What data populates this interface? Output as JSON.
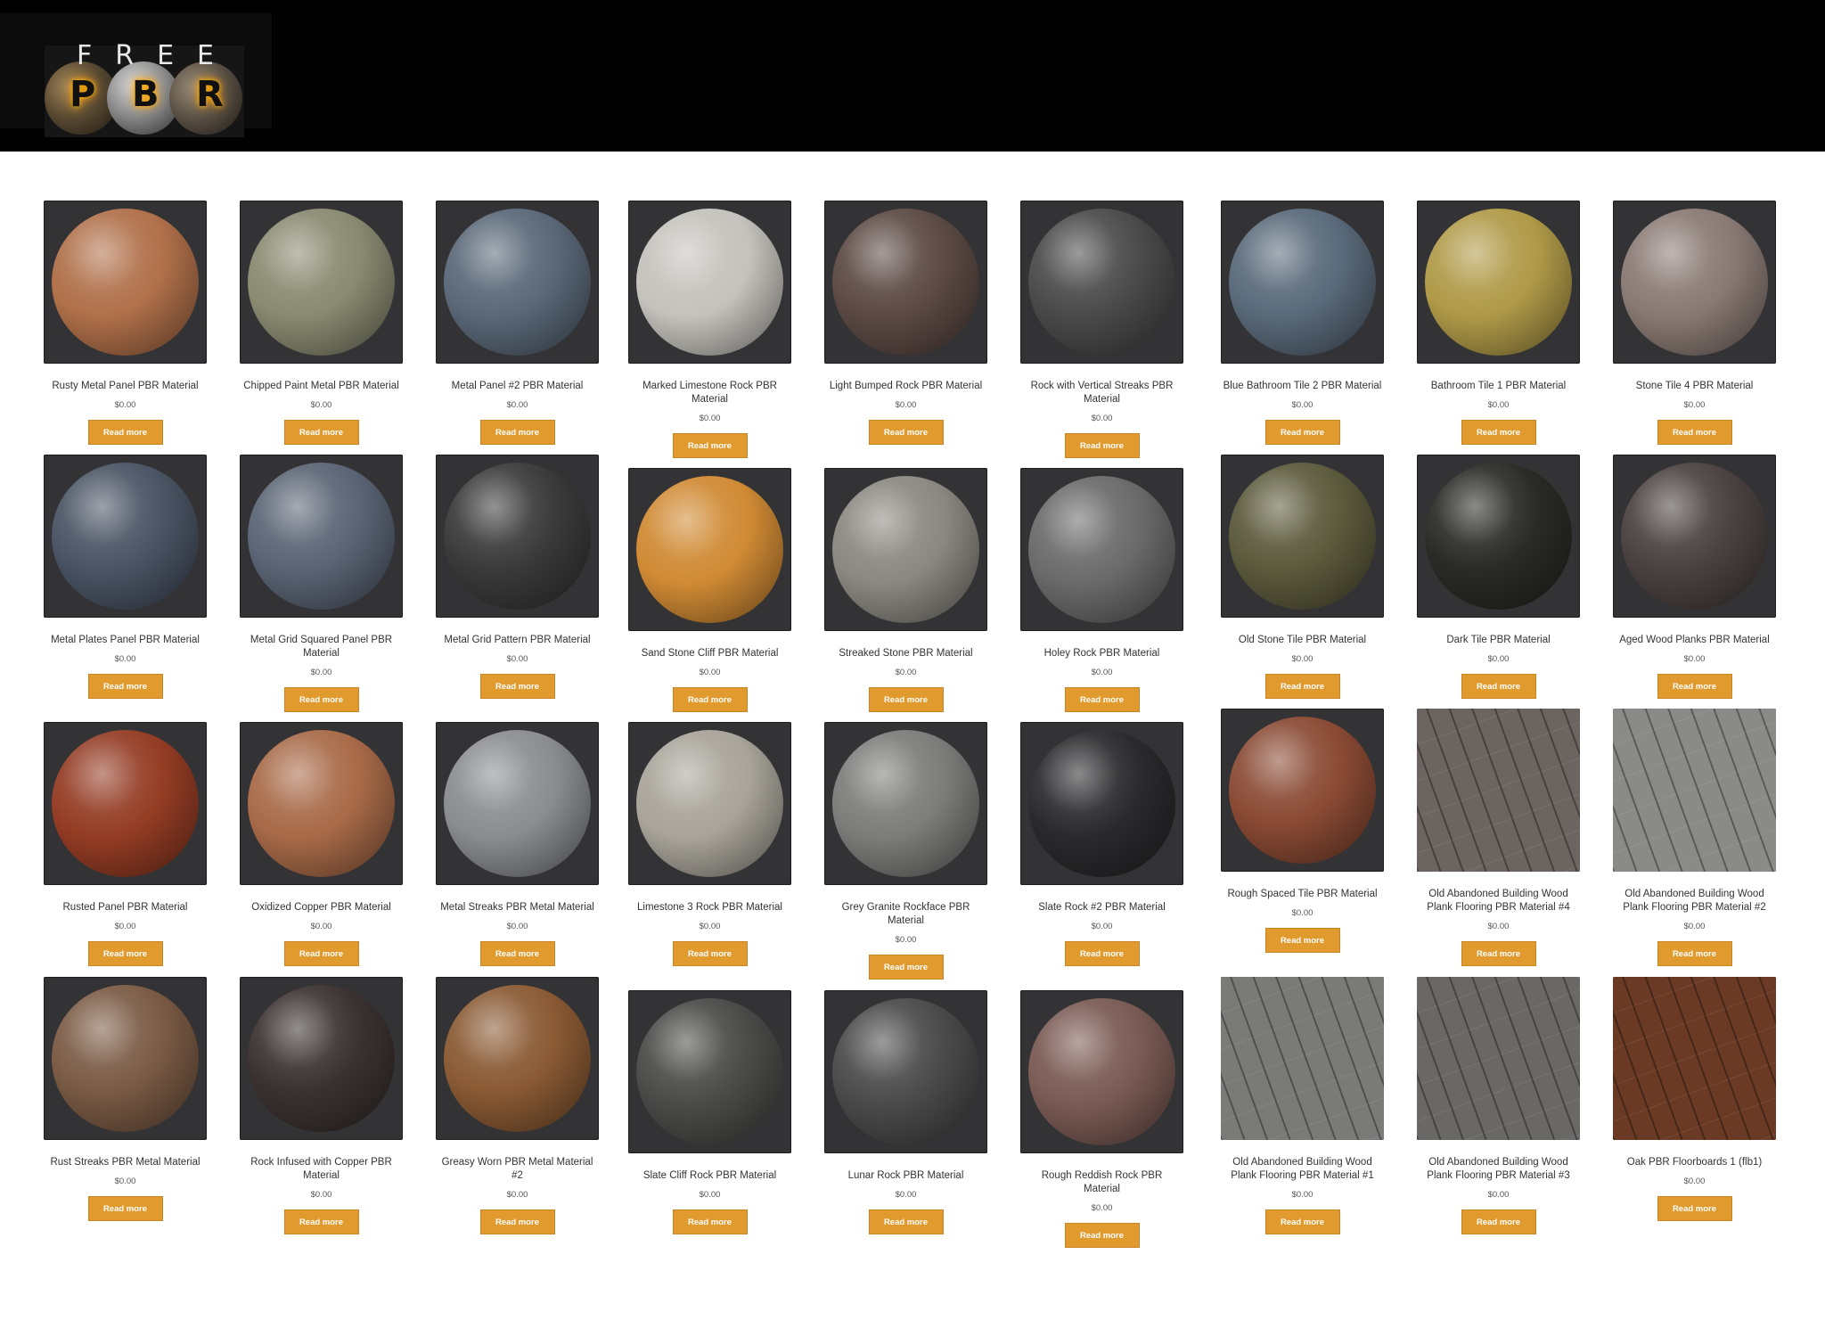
{
  "logo": {
    "top_text": "FREE",
    "letters": [
      "P",
      "B",
      "R"
    ]
  },
  "products": [
    {
      "title": "Rusty Metal Panel PBR Material",
      "price": "$0.00",
      "button": "Read more",
      "color": "#b0704a"
    },
    {
      "title": "Chipped Paint Metal PBR Material",
      "price": "$0.00",
      "button": "Read more",
      "color": "#8a8a72"
    },
    {
      "title": "Metal Panel #2 PBR Material",
      "price": "$0.00",
      "button": "Read more",
      "color": "#5a6878"
    },
    {
      "title": "Marked Limestone Rock PBR Material",
      "price": "$0.00",
      "button": "Read more",
      "color": "#c4c2bc"
    },
    {
      "title": "Light Bumped Rock PBR Material",
      "price": "$0.00",
      "button": "Read more",
      "color": "#5c4a44"
    },
    {
      "title": "Rock with Vertical Streaks PBR Material",
      "price": "$0.00",
      "button": "Read more",
      "color": "#4a4a4a"
    },
    {
      "title": "Blue Bathroom Tile 2 PBR Material",
      "price": "$0.00",
      "button": "Read more",
      "color": "#5a6a7a"
    },
    {
      "title": "Bathroom Tile 1 PBR Material",
      "price": "$0.00",
      "button": "Read more",
      "color": "#b09a48"
    },
    {
      "title": "Stone Tile 4 PBR Material",
      "price": "$0.00",
      "button": "Read more",
      "color": "#8a7a74"
    },
    {
      "title": "Metal Plates Panel PBR Material",
      "price": "$0.00",
      "button": "Read more",
      "color": "#4a5464"
    },
    {
      "title": "Metal Grid Squared Panel PBR Material",
      "price": "$0.00",
      "button": "Read more",
      "color": "#5a6474"
    },
    {
      "title": "Metal Grid Pattern PBR Material",
      "price": "$0.00",
      "button": "Read more",
      "color": "#3a3a3a"
    },
    {
      "title": "Sand Stone Cliff PBR Material",
      "price": "$0.00",
      "button": "Read more",
      "color": "#d08a34"
    },
    {
      "title": "Streaked Stone PBR Material",
      "price": "$0.00",
      "button": "Read more",
      "color": "#8a8880"
    },
    {
      "title": "Holey Rock PBR Material",
      "price": "$0.00",
      "button": "Read more",
      "color": "#6a6a6a"
    },
    {
      "title": "Old Stone Tile PBR Material",
      "price": "$0.00",
      "button": "Read more",
      "color": "#5c5a3c"
    },
    {
      "title": "Dark Tile PBR Material",
      "price": "$0.00",
      "button": "Read more",
      "color": "#2a2a26"
    },
    {
      "title": "Aged Wood Planks PBR Material",
      "price": "$0.00",
      "button": "Read more",
      "color": "#4a4240"
    },
    {
      "title": "Rusted Panel PBR Material",
      "price": "$0.00",
      "button": "Read more",
      "color": "#943c24"
    },
    {
      "title": "Oxidized Copper PBR Material",
      "price": "$0.00",
      "button": "Read more",
      "color": "#a86a48"
    },
    {
      "title": "Metal Streaks PBR Metal Material",
      "price": "$0.00",
      "button": "Read more",
      "color": "#8a8c90"
    },
    {
      "title": "Limestone 3 Rock PBR Material",
      "price": "$0.00",
      "button": "Read more",
      "color": "#a8a49a"
    },
    {
      "title": "Grey Granite Rockface PBR Material",
      "price": "$0.00",
      "button": "Read more",
      "color": "#7c7c7a"
    },
    {
      "title": "Slate Rock #2 PBR Material",
      "price": "$0.00",
      "button": "Read more",
      "color": "#2a2a2c"
    },
    {
      "title": "Rough Spaced Tile PBR Material",
      "price": "$0.00",
      "button": "Read more",
      "color": "#8a4a34"
    },
    {
      "title": "Old Abandoned Building Wood Plank Flooring PBR Material #4",
      "price": "$0.00",
      "button": "Read more",
      "color": "#6c6460"
    },
    {
      "title": "Old Abandoned Building Wood Plank Flooring PBR Material #2",
      "price": "$0.00",
      "button": "Read more",
      "color": "#8a8a88"
    },
    {
      "title": "Rust Streaks PBR Metal Material",
      "price": "$0.00",
      "button": "Read more",
      "color": "#7a5a44"
    },
    {
      "title": "Rock Infused with Copper PBR Material",
      "price": "$0.00",
      "button": "Read more",
      "color": "#3a3230"
    },
    {
      "title": "Greasy Worn PBR Metal Material #2",
      "price": "$0.00",
      "button": "Read more",
      "color": "#8a5a34"
    },
    {
      "title": "Slate Cliff Rock PBR Material",
      "price": "$0.00",
      "button": "Read more",
      "color": "#4a4a48"
    },
    {
      "title": "Lunar Rock PBR Material",
      "price": "$0.00",
      "button": "Read more",
      "color": "#4a4a4a"
    },
    {
      "title": "Rough Reddish Rock PBR Material",
      "price": "$0.00",
      "button": "Read more",
      "color": "#7a5a54"
    },
    {
      "title": "Old Abandoned Building Wood Plank Flooring PBR Material #1",
      "price": "$0.00",
      "button": "Read more",
      "color": "#7a7a78"
    },
    {
      "title": "Old Abandoned Building Wood Plank Flooring PBR Material #3",
      "price": "$0.00",
      "button": "Read more",
      "color": "#6a6866"
    },
    {
      "title": "Oak PBR Floorboards 1 (flb1)",
      "price": "$0.00",
      "button": "Read more",
      "color": "#6a3a24"
    }
  ]
}
